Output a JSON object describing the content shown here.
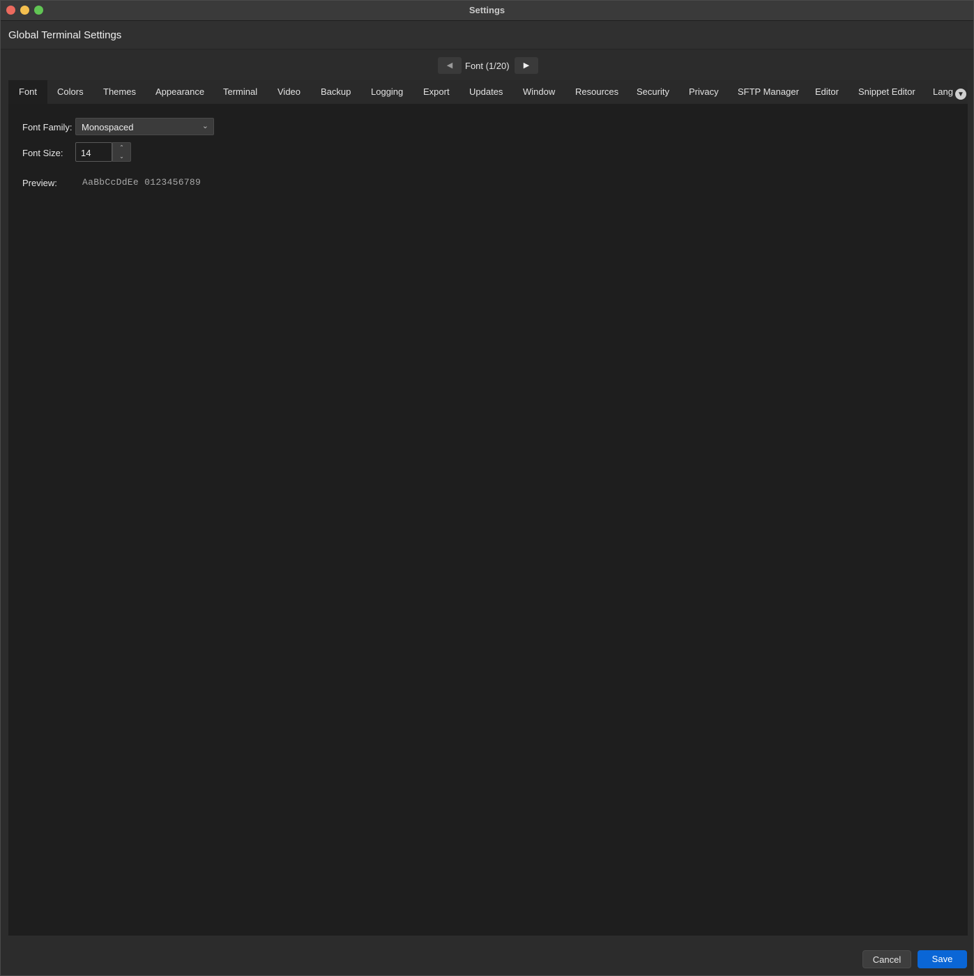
{
  "window": {
    "title": "Settings"
  },
  "header": {
    "title": "Global Terminal Settings"
  },
  "pager": {
    "prev_icon": "triangle-left",
    "next_icon": "triangle-right",
    "label": "Font (1/20)"
  },
  "tabs": [
    {
      "label": "Font",
      "active": true
    },
    {
      "label": "Colors"
    },
    {
      "label": "Themes"
    },
    {
      "label": "Appearance"
    },
    {
      "label": "Terminal"
    },
    {
      "label": "Video"
    },
    {
      "label": "Backup"
    },
    {
      "label": "Logging"
    },
    {
      "label": "Export"
    },
    {
      "label": "Updates"
    },
    {
      "label": "Window"
    },
    {
      "label": "Resources"
    },
    {
      "label": "Security"
    },
    {
      "label": "Privacy"
    },
    {
      "label": "SFTP Manager"
    },
    {
      "label": "Editor"
    },
    {
      "label": "Snippet Editor"
    },
    {
      "label": "Lang"
    }
  ],
  "font": {
    "family_label": "Font Family:",
    "family_value": "Monospaced",
    "size_label": "Font Size:",
    "size_value": "14",
    "preview_label": "Preview:",
    "preview_text": "AaBbCcDdEe 0123456789"
  },
  "footer": {
    "cancel_label": "Cancel",
    "save_label": "Save"
  },
  "colors": {
    "accent": "#0a66d6",
    "close": "#ec6a5e",
    "minimize": "#f4bf4f",
    "maximize": "#61c554"
  }
}
